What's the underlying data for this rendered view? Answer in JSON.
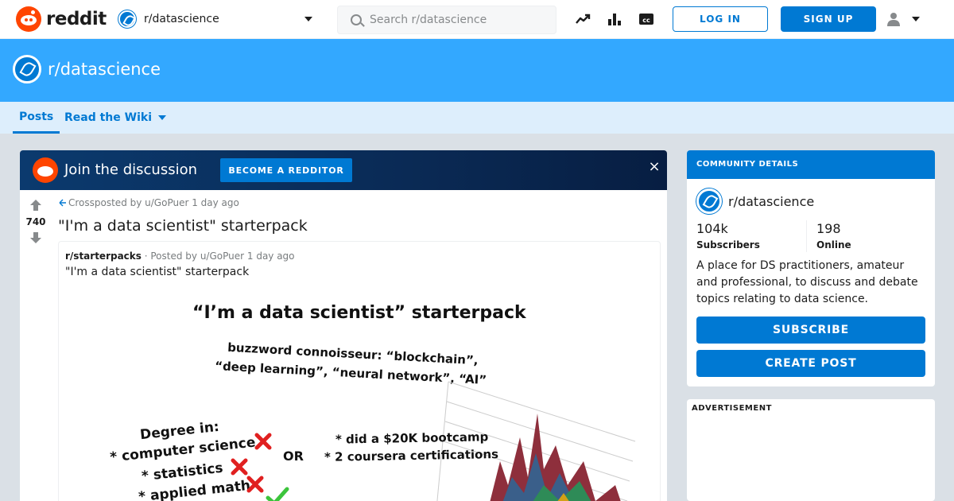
{
  "header": {
    "logo_text": "reddit",
    "subreddit_select": "r/datascience",
    "search_placeholder": "Search r/datascience",
    "login_label": "LOG IN",
    "signup_label": "SIGN UP",
    "icons": [
      "trending-icon",
      "popular-icon",
      "cc-icon",
      "user-icon",
      "chevron-down-icon"
    ]
  },
  "banner": {
    "title": "r/datascience"
  },
  "subnav": {
    "tabs": [
      {
        "label": "Posts"
      },
      {
        "label": "Read the Wiki"
      }
    ]
  },
  "join": {
    "text": "Join the discussion",
    "button_label": "BECOME A REDDITOR",
    "close": "×"
  },
  "post": {
    "score": "740",
    "crosspost": "Crossposted by u/GoPuer 1 day ago",
    "title": "\"I'm a data scientist\" starterpack",
    "inner": {
      "subreddit": "r/starterpacks",
      "meta": " · Posted by u/GoPuer 1 day ago",
      "title": "\"I'm a data scientist\" starterpack"
    },
    "meme": {
      "heading": "“I’m a data scientist” starterpack",
      "buzz_line1": "buzzword connoisseur: “blockchain”,",
      "buzz_line2": "“deep learning”, “neural network”, “AI”",
      "degree_title": "Degree in:",
      "degree_1": "* computer science",
      "degree_2": "* statistics",
      "degree_3": "* applied math",
      "or_text": "OR",
      "alt_1": "* did a $20K bootcamp",
      "alt_2": "* 2 coursera certifications"
    }
  },
  "sidebar": {
    "header": "COMMUNITY DETAILS",
    "name": "r/datascience",
    "subscribers_value": "104k",
    "subscribers_label": "Subscribers",
    "online_value": "198",
    "online_label": "Online",
    "description": "A place for DS practitioners, amateur and professional, to discuss and debate topics relating to data science.",
    "subscribe_label": "SUBSCRIBE",
    "create_post_label": "CREATE POST",
    "advertisement_label": "ADVERTISEMENT"
  },
  "colors": {
    "brand": "#ff4500",
    "accent": "#0079d3",
    "banner": "#33a8ff",
    "subnav": "#ddeefc",
    "page_bg": "#dae0e6"
  }
}
